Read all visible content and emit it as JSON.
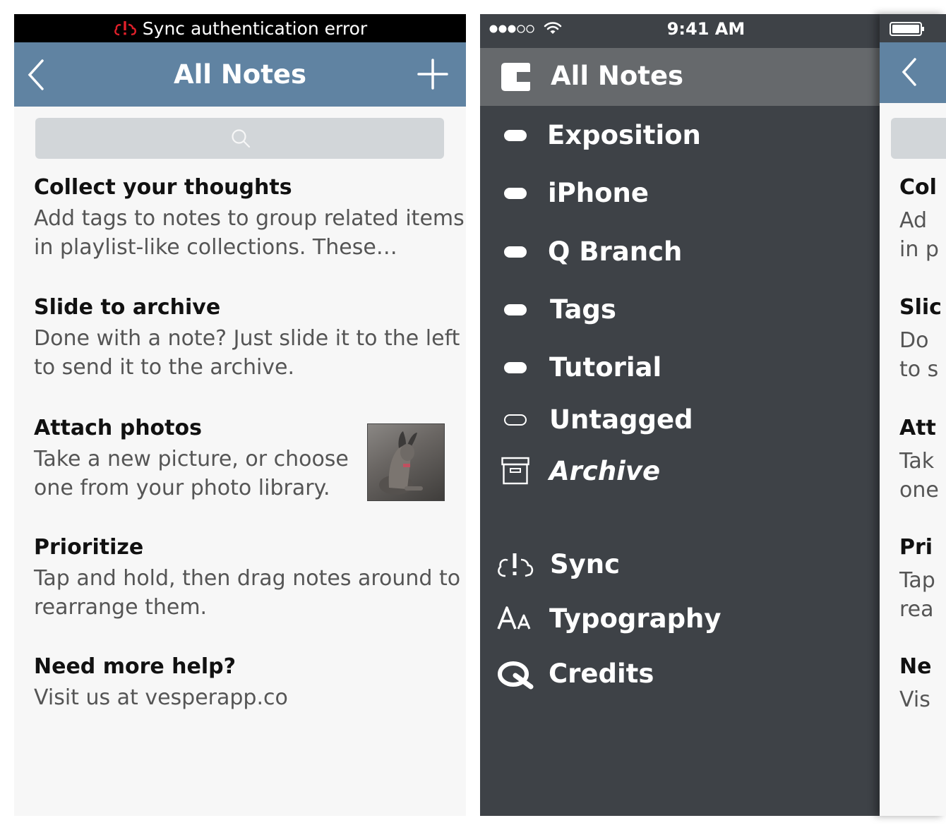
{
  "left_screen": {
    "sync_error": "Sync authentication error",
    "nav_title": "All Notes",
    "notes": [
      {
        "title": "Collect your thoughts",
        "line1": "Add tags to notes to group related items",
        "line2": "in playlist-like collections. These…"
      },
      {
        "title": "Slide to archive",
        "line1": "Done with a note? Just slide it to the left",
        "line2": "to send it to the archive."
      },
      {
        "title": "Attach photos",
        "line1": "Take a new picture, or choose",
        "line2": "one from your photo library."
      },
      {
        "title": "Prioritize",
        "line1": "Tap and hold, then drag notes around to",
        "line2": "rearrange them."
      },
      {
        "title": "Need more help?",
        "line1": "Visit us at vesperapp.co",
        "line2": ""
      }
    ]
  },
  "menu": {
    "status_time": "9:41 AM",
    "selected": "All Notes",
    "tags": [
      "Exposition",
      "iPhone",
      "Q Branch",
      "Tags",
      "Tutorial"
    ],
    "untagged": "Untagged",
    "archive": "Archive",
    "sync": "Sync",
    "typography": "Typography",
    "credits": "Credits"
  },
  "right_screen": {
    "snippets": [
      "Col",
      "Ad",
      "in p",
      "Slic",
      "Do",
      "to s",
      "Att",
      "Tak",
      "one",
      "Pri",
      "Tap",
      "rea",
      "Ne",
      "Vis"
    ]
  },
  "colors": {
    "nav_blue": "#6083a2",
    "menu_bg": "#3e4247",
    "menu_selected": "#66696c",
    "list_bg": "#f7f7f7",
    "search_bg": "#d2d6d9",
    "error_red": "#e0202a"
  },
  "icons": {
    "sync_error": "cloud-alert-icon",
    "back": "chevron-left-icon",
    "add": "plus-icon",
    "search": "search-icon",
    "all_notes": "notes-icon",
    "tag": "tag-icon",
    "archive": "archive-box-icon",
    "typography": "font-size-icon",
    "credits": "q-logo-icon"
  }
}
